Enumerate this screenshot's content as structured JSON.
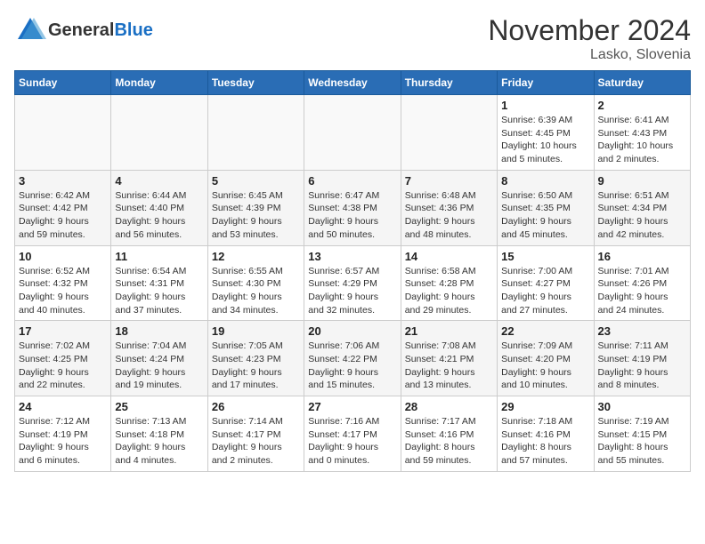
{
  "header": {
    "logo_general": "General",
    "logo_blue": "Blue",
    "month": "November 2024",
    "location": "Lasko, Slovenia"
  },
  "weekdays": [
    "Sunday",
    "Monday",
    "Tuesday",
    "Wednesday",
    "Thursday",
    "Friday",
    "Saturday"
  ],
  "weeks": [
    [
      {
        "day": "",
        "info": ""
      },
      {
        "day": "",
        "info": ""
      },
      {
        "day": "",
        "info": ""
      },
      {
        "day": "",
        "info": ""
      },
      {
        "day": "",
        "info": ""
      },
      {
        "day": "1",
        "info": "Sunrise: 6:39 AM\nSunset: 4:45 PM\nDaylight: 10 hours\nand 5 minutes."
      },
      {
        "day": "2",
        "info": "Sunrise: 6:41 AM\nSunset: 4:43 PM\nDaylight: 10 hours\nand 2 minutes."
      }
    ],
    [
      {
        "day": "3",
        "info": "Sunrise: 6:42 AM\nSunset: 4:42 PM\nDaylight: 9 hours\nand 59 minutes."
      },
      {
        "day": "4",
        "info": "Sunrise: 6:44 AM\nSunset: 4:40 PM\nDaylight: 9 hours\nand 56 minutes."
      },
      {
        "day": "5",
        "info": "Sunrise: 6:45 AM\nSunset: 4:39 PM\nDaylight: 9 hours\nand 53 minutes."
      },
      {
        "day": "6",
        "info": "Sunrise: 6:47 AM\nSunset: 4:38 PM\nDaylight: 9 hours\nand 50 minutes."
      },
      {
        "day": "7",
        "info": "Sunrise: 6:48 AM\nSunset: 4:36 PM\nDaylight: 9 hours\nand 48 minutes."
      },
      {
        "day": "8",
        "info": "Sunrise: 6:50 AM\nSunset: 4:35 PM\nDaylight: 9 hours\nand 45 minutes."
      },
      {
        "day": "9",
        "info": "Sunrise: 6:51 AM\nSunset: 4:34 PM\nDaylight: 9 hours\nand 42 minutes."
      }
    ],
    [
      {
        "day": "10",
        "info": "Sunrise: 6:52 AM\nSunset: 4:32 PM\nDaylight: 9 hours\nand 40 minutes."
      },
      {
        "day": "11",
        "info": "Sunrise: 6:54 AM\nSunset: 4:31 PM\nDaylight: 9 hours\nand 37 minutes."
      },
      {
        "day": "12",
        "info": "Sunrise: 6:55 AM\nSunset: 4:30 PM\nDaylight: 9 hours\nand 34 minutes."
      },
      {
        "day": "13",
        "info": "Sunrise: 6:57 AM\nSunset: 4:29 PM\nDaylight: 9 hours\nand 32 minutes."
      },
      {
        "day": "14",
        "info": "Sunrise: 6:58 AM\nSunset: 4:28 PM\nDaylight: 9 hours\nand 29 minutes."
      },
      {
        "day": "15",
        "info": "Sunrise: 7:00 AM\nSunset: 4:27 PM\nDaylight: 9 hours\nand 27 minutes."
      },
      {
        "day": "16",
        "info": "Sunrise: 7:01 AM\nSunset: 4:26 PM\nDaylight: 9 hours\nand 24 minutes."
      }
    ],
    [
      {
        "day": "17",
        "info": "Sunrise: 7:02 AM\nSunset: 4:25 PM\nDaylight: 9 hours\nand 22 minutes."
      },
      {
        "day": "18",
        "info": "Sunrise: 7:04 AM\nSunset: 4:24 PM\nDaylight: 9 hours\nand 19 minutes."
      },
      {
        "day": "19",
        "info": "Sunrise: 7:05 AM\nSunset: 4:23 PM\nDaylight: 9 hours\nand 17 minutes."
      },
      {
        "day": "20",
        "info": "Sunrise: 7:06 AM\nSunset: 4:22 PM\nDaylight: 9 hours\nand 15 minutes."
      },
      {
        "day": "21",
        "info": "Sunrise: 7:08 AM\nSunset: 4:21 PM\nDaylight: 9 hours\nand 13 minutes."
      },
      {
        "day": "22",
        "info": "Sunrise: 7:09 AM\nSunset: 4:20 PM\nDaylight: 9 hours\nand 10 minutes."
      },
      {
        "day": "23",
        "info": "Sunrise: 7:11 AM\nSunset: 4:19 PM\nDaylight: 9 hours\nand 8 minutes."
      }
    ],
    [
      {
        "day": "24",
        "info": "Sunrise: 7:12 AM\nSunset: 4:19 PM\nDaylight: 9 hours\nand 6 minutes."
      },
      {
        "day": "25",
        "info": "Sunrise: 7:13 AM\nSunset: 4:18 PM\nDaylight: 9 hours\nand 4 minutes."
      },
      {
        "day": "26",
        "info": "Sunrise: 7:14 AM\nSunset: 4:17 PM\nDaylight: 9 hours\nand 2 minutes."
      },
      {
        "day": "27",
        "info": "Sunrise: 7:16 AM\nSunset: 4:17 PM\nDaylight: 9 hours\nand 0 minutes."
      },
      {
        "day": "28",
        "info": "Sunrise: 7:17 AM\nSunset: 4:16 PM\nDaylight: 8 hours\nand 59 minutes."
      },
      {
        "day": "29",
        "info": "Sunrise: 7:18 AM\nSunset: 4:16 PM\nDaylight: 8 hours\nand 57 minutes."
      },
      {
        "day": "30",
        "info": "Sunrise: 7:19 AM\nSunset: 4:15 PM\nDaylight: 8 hours\nand 55 minutes."
      }
    ]
  ]
}
